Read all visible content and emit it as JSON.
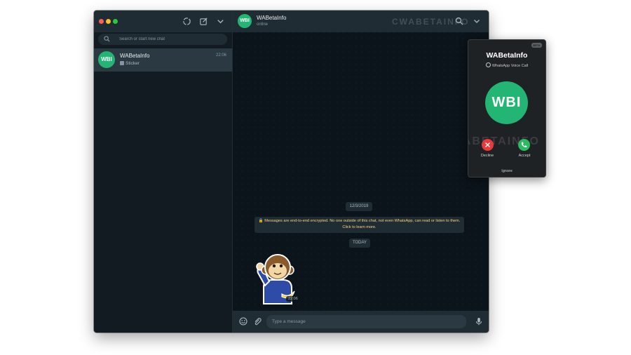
{
  "sidebar": {
    "search_placeholder": "Search or start new chat",
    "chats": [
      {
        "avatar_text": "WBI",
        "name": "WABetaInfo",
        "time": "22:06",
        "preview": "Sticker"
      }
    ]
  },
  "chat": {
    "avatar_text": "WBI",
    "name": "WABetaInfo",
    "status": "online",
    "watermark": "CWABETAINFO",
    "date_label": "12/3/2019",
    "encryption_notice": "Messages are end-to-end encrypted. No one outside of this chat, not even WhatsApp, can read or listen to them. Click to learn more.",
    "today_label": "TODAY",
    "sticker_time": "22:06",
    "composer_placeholder": "Type a message"
  },
  "call": {
    "badge": "BETA",
    "name": "WABetaInfo",
    "subtitle": "WhatsApp Voice Call",
    "avatar_text": "WBI",
    "decline_label": "Decline",
    "accept_label": "Accept",
    "ignore_label": "Ignore",
    "watermark": "CWABETAINFO"
  },
  "colors": {
    "accent": "#22b573",
    "decline": "#ea3b3b",
    "accept": "#2dba61",
    "encryption_text": "#ffd279"
  },
  "icons": [
    "status-icon",
    "new-chat-icon",
    "menu-chevron-icon",
    "search-icon",
    "emoji-icon",
    "attach-icon",
    "microphone-icon",
    "close-icon",
    "phone-icon"
  ]
}
